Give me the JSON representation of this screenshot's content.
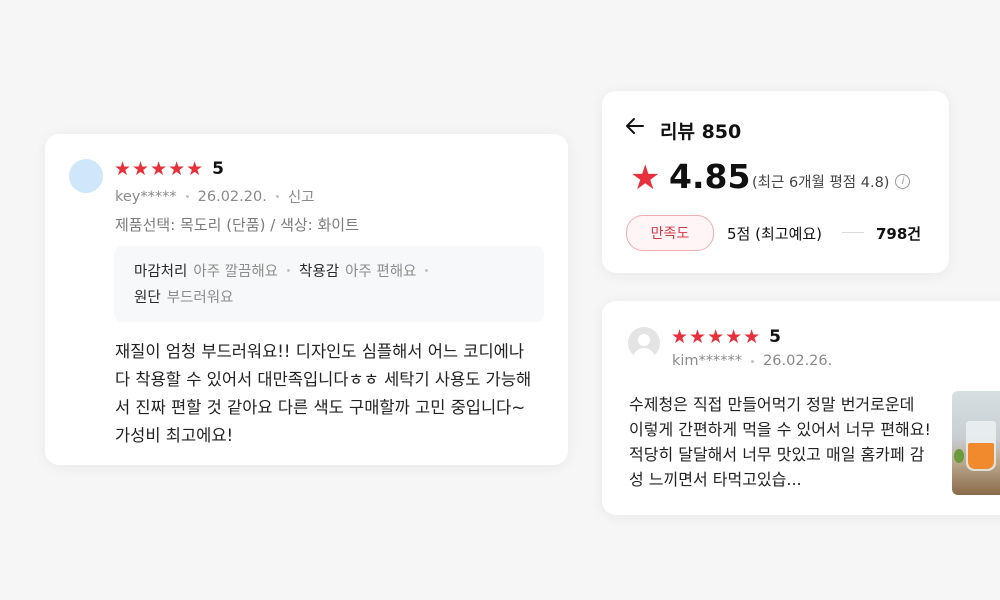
{
  "review1": {
    "stars": "★★★★★",
    "rating": "5",
    "user": "key*****",
    "date": "26.02.20.",
    "report": "신고",
    "option": "제품선택: 목도리 (단품) / 색상: 화이트",
    "attributes": [
      {
        "key": "마감처리",
        "value": "아주 깔끔해요"
      },
      {
        "key": "착용감",
        "value": "아주 편해요"
      },
      {
        "key": "원단",
        "value": "부드러워요"
      }
    ],
    "text": "재질이 엄청 부드러워요!! 디자인도 심플해서 어느 코디에나 다 착용할 수 있어서 대만족입니다ㅎㅎ 세탁기 사용도 가능해서 진짜 편할 것 같아요 다른 색도 구매할까 고민 중입니다~ 가성비 최고에요!"
  },
  "summary": {
    "back_icon": "arrow-left-icon",
    "title": "리뷰 850",
    "score": "4.85",
    "recent": "(최근 6개월 평점 4.8)",
    "badge": "만족도",
    "five_label": "5점 (최고예요)",
    "count": "798건",
    "accent": "#e8303c"
  },
  "review2": {
    "stars": "★★★★★",
    "rating": "5",
    "user": "kim******",
    "date": "26.02.26.",
    "text": "수제청은 직접 만들어먹기 정말 번거로운데 이렇게 간편하게 먹을 수 있어서 너무 편해요! 적당히 달달해서 너무 맛있고 매일 홈카페 감성 느끼면서 타먹고있습..."
  }
}
